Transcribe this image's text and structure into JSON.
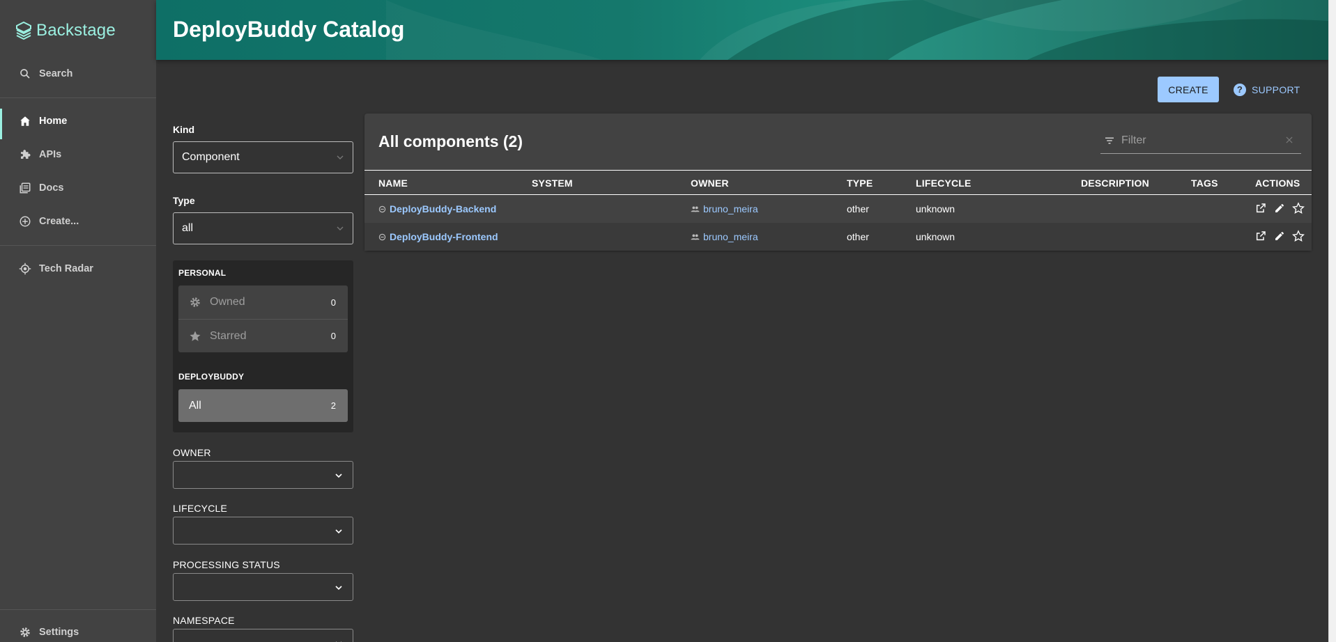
{
  "sidebar": {
    "logo_text": "Backstage",
    "search_label": "Search",
    "items": [
      {
        "label": "Home",
        "icon": "home-icon"
      },
      {
        "label": "APIs",
        "icon": "puzzle-icon"
      },
      {
        "label": "Docs",
        "icon": "docs-icon"
      },
      {
        "label": "Create...",
        "icon": "add-circle-icon"
      }
    ],
    "tech_radar_label": "Tech Radar",
    "settings_label": "Settings"
  },
  "header": {
    "title": "DeployBuddy Catalog"
  },
  "toolbar": {
    "create_label": "CREATE",
    "support_label": "SUPPORT"
  },
  "filters": {
    "kind_label": "Kind",
    "kind_value": "Component",
    "type_label": "Type",
    "type_value": "all",
    "personal_heading": "PERSONAL",
    "owned_label": "Owned",
    "owned_count": "0",
    "starred_label": "Starred",
    "starred_count": "0",
    "org_heading": "DEPLOYBUDDY",
    "all_label": "All",
    "all_count": "2",
    "owner_label": "OWNER",
    "lifecycle_label": "LIFECYCLE",
    "processing_status_label": "PROCESSING STATUS",
    "namespace_label": "NAMESPACE"
  },
  "table": {
    "title": "All components (2)",
    "filter_placeholder": "Filter",
    "columns": [
      "NAME",
      "SYSTEM",
      "OWNER",
      "TYPE",
      "LIFECYCLE",
      "DESCRIPTION",
      "TAGS",
      "ACTIONS"
    ],
    "rows": [
      {
        "name": "DeployBuddy-Backend",
        "system": "",
        "owner": "bruno_meira",
        "type": "other",
        "lifecycle": "unknown",
        "description": "",
        "tags": ""
      },
      {
        "name": "DeployBuddy-Frontend",
        "system": "",
        "owner": "bruno_meira",
        "type": "other",
        "lifecycle": "unknown",
        "description": "",
        "tags": ""
      }
    ]
  },
  "colors": {
    "accent": "#9bf0e1",
    "link": "#9cc9ff",
    "header": "#15786c",
    "background": "#333333"
  }
}
